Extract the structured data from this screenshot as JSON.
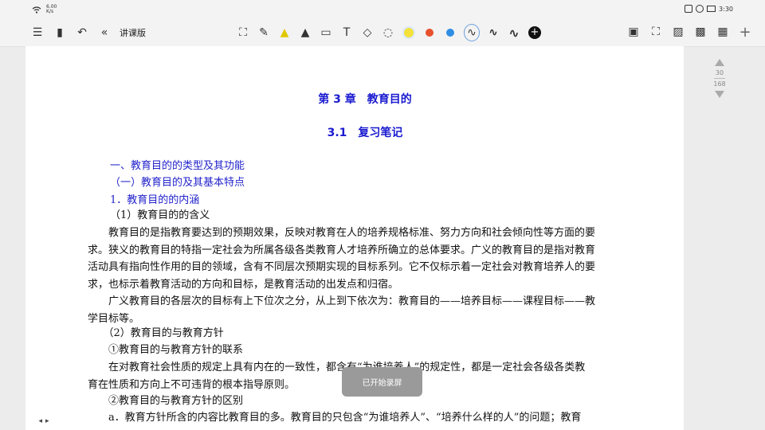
{
  "status_bar": {
    "wifi_icon": "wifi-icon",
    "speed": "6.00 K/s",
    "time": "3:30",
    "icons": [
      "screen-record-icon",
      "no-sound-icon",
      "battery-icon"
    ]
  },
  "toolbar": {
    "mode_label": "讲课版",
    "left_icons": [
      "list-icon",
      "save-icon",
      "undo-icon",
      "collapse-icon"
    ],
    "center_tools": [
      "selection-icon",
      "pen-icon",
      "highlighter-icon",
      "marker-icon",
      "eraser-icon",
      "text-icon",
      "shapes-icon",
      "lasso-icon"
    ],
    "colors": [
      "#f4e13a",
      "#e8502e",
      "#2f8de4"
    ],
    "stroke_icons": [
      "thin-wave-icon",
      "medium-wave-icon",
      "thick-wave-icon"
    ],
    "right_icons": [
      "save-disk-icon",
      "fullscreen-icon",
      "image-icon",
      "export-icon",
      "page-grid-icon",
      "add-icon"
    ]
  },
  "document": {
    "chapter_title": "第 3 章　教育目的",
    "section_title": "3.1　复习笔记",
    "heading1": "一、教育目的的类型及其功能",
    "heading2": "（一）教育目的及其基本特点",
    "heading3": "1．教育目的的内涵",
    "heading4": "（1）教育目的的含义",
    "para1": [
      "　　教育目的是指教育要达到的预期效果，反映对教育在人的培养规格标准、努力方向和社会倾向性等方面的要",
      "求。狭义的教育目的特指一定社会为所属各级各类教育人才培养所确立的总体要求。广义的教育目的是指对教育",
      "活动具有指向性作用的目的领域，含有不同层次预期实现的目标系列。它不仅标示着一定社会对教育培养人的要",
      "求，也标示着教育活动的方向和目标，是教育活动的出发点和归宿。"
    ],
    "para2": [
      "　　广义教育目的各层次的目标有上下位次之分，从上到下依次为：教育目的——培养目标——课程目标——教",
      "学目标等。"
    ],
    "heading5": "　　（2）教育目的与教育方针",
    "heading6": "　　①教育目的与教育方针的联系",
    "para3": [
      "　　在对教育社会性质的规定上具有内在的一致性，都含有“为谁培养人”的规定性，都是一定社会各级各类教",
      "育在性质和方向上不可违背的根本指导原则。"
    ],
    "heading7": "　　②教育目的与教育方针的区别",
    "para4": "　　a．教育方针所含的内容比教育目的多。教育目的只包含“为谁培养人”、“培养什么样的人”的问题；教育"
  },
  "scroll": {
    "current_page": "30",
    "total_pages": "168"
  },
  "toast": "已开始录屏"
}
